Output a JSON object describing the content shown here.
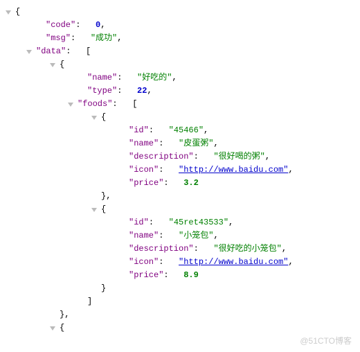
{
  "root": {
    "code_key": "\"code\"",
    "code_val": "0",
    "msg_key": "\"msg\"",
    "msg_val": "\"成功\"",
    "data_key": "\"data\""
  },
  "item0": {
    "name_key": "\"name\"",
    "name_val": "\"好吃的\"",
    "type_key": "\"type\"",
    "type_val": "22",
    "foods_key": "\"foods\""
  },
  "food0": {
    "id_key": "\"id\"",
    "id_val": "\"45466\"",
    "name_key": "\"name\"",
    "name_val": "\"皮蛋粥\"",
    "desc_key": "\"description\"",
    "desc_val": "\"很好喝的粥\"",
    "icon_key": "\"icon\"",
    "icon_val": "\"http://www.baidu.com\"",
    "price_key": "\"price\"",
    "price_val": "3.2"
  },
  "food1": {
    "id_key": "\"id\"",
    "id_val": "\"45ret43533\"",
    "name_key": "\"name\"",
    "name_val": "\"小笼包\"",
    "desc_key": "\"description\"",
    "desc_val": "\"很好吃的小笼包\"",
    "icon_key": "\"icon\"",
    "icon_val": "\"http://www.baidu.com\"",
    "price_key": "\"price\"",
    "price_val": "8.9"
  },
  "watermark": "@51CTO博客"
}
